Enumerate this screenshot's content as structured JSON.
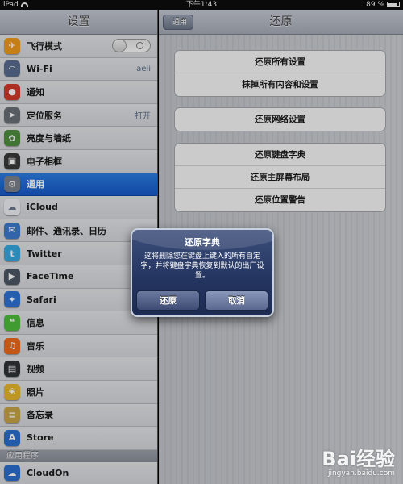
{
  "status_bar": {
    "device": "iPad",
    "time": "下午1:43",
    "battery": "89 %"
  },
  "sidebar": {
    "title": "设置",
    "items": [
      {
        "label": "飞行模式",
        "icon": "airplane-icon",
        "color": "#f29a1d",
        "glyph": "✈"
      },
      {
        "label": "Wi-Fi",
        "value": "aeli",
        "icon": "wifi-icon",
        "color": "#5a6c8e",
        "glyph": "◠"
      },
      {
        "label": "通知",
        "icon": "notifications-icon",
        "color": "#d33a2c",
        "glyph": "●"
      },
      {
        "label": "定位服务",
        "value": "打开",
        "icon": "location-icon",
        "color": "#6a6f78",
        "glyph": "➤"
      },
      {
        "label": "亮度与墙纸",
        "icon": "brightness-icon",
        "color": "#4f8f3f",
        "glyph": "✿"
      },
      {
        "label": "电子相框",
        "icon": "picture-frame-icon",
        "color": "#3a3a3a",
        "glyph": "▣"
      },
      {
        "label": "通用",
        "icon": "gear-icon",
        "color": "#7d838d",
        "glyph": "⚙"
      },
      {
        "label": "iCloud",
        "icon": "cloud-icon",
        "color": "#eef1f5",
        "glyph": "☁"
      },
      {
        "label": "邮件、通讯录、日历",
        "icon": "mail-icon",
        "color": "#3e7bd0",
        "glyph": "✉"
      },
      {
        "label": "Twitter",
        "icon": "twitter-icon",
        "color": "#35a9e0",
        "glyph": "t"
      },
      {
        "label": "FaceTime",
        "icon": "facetime-icon",
        "color": "#4d5865",
        "glyph": "▶"
      },
      {
        "label": "Safari",
        "icon": "safari-icon",
        "color": "#2e72d6",
        "glyph": "✦"
      },
      {
        "label": "信息",
        "icon": "messages-icon",
        "color": "#4fbf3c",
        "glyph": "❝"
      },
      {
        "label": "音乐",
        "icon": "music-icon",
        "color": "#ef6a1c",
        "glyph": "♫"
      },
      {
        "label": "视频",
        "icon": "video-icon",
        "color": "#2f3438",
        "glyph": "▤"
      },
      {
        "label": "照片",
        "icon": "photos-icon",
        "color": "#e7b82c",
        "glyph": "❀"
      },
      {
        "label": "备忘录",
        "icon": "notes-icon",
        "color": "#c9a545",
        "glyph": "≡"
      },
      {
        "label": "Store",
        "icon": "app-store-icon",
        "color": "#2b6fd0",
        "glyph": "A"
      }
    ],
    "section_label": "应用程序",
    "apps": [
      {
        "label": "CloudOn",
        "icon": "cloudon-icon",
        "color": "#2b6fd0",
        "glyph": "☁"
      }
    ]
  },
  "main": {
    "title": "还原",
    "back_label": "通用",
    "groups": [
      [
        "还原所有设置",
        "抹掉所有内容和设置"
      ],
      [
        "还原网络设置"
      ],
      [
        "还原键盘字典",
        "还原主屏幕布局",
        "还原位置警告"
      ]
    ]
  },
  "alert": {
    "title": "还原字典",
    "message": "这将删除您在键盘上键入的所有自定字，并将键盘字典恢复到默认的出厂设置。",
    "confirm_label": "还原",
    "cancel_label": "取消"
  },
  "watermark": {
    "logo_text": "Bai经验",
    "url": "jingyan.baidu.com"
  }
}
